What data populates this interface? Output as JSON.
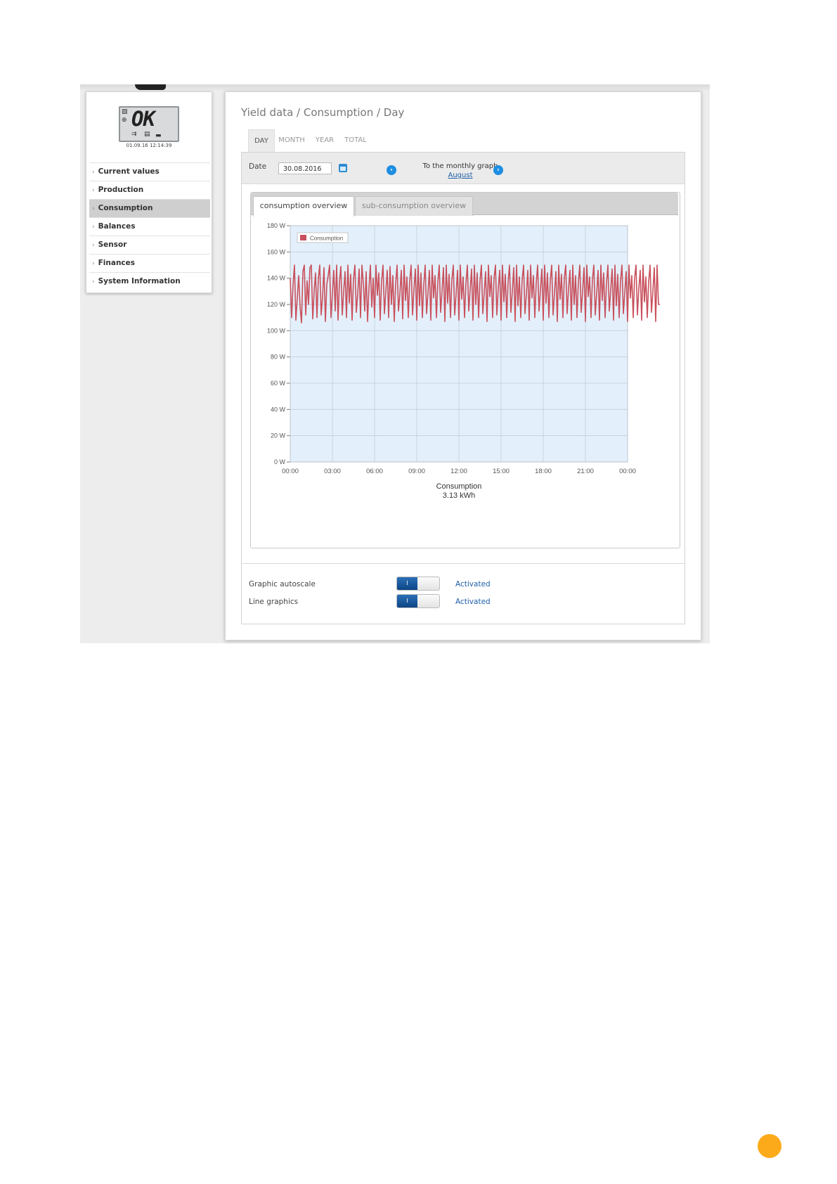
{
  "device": {
    "status_text": "OK",
    "timestamp": "01.09.16 12:14:39"
  },
  "sidebar": {
    "items": [
      {
        "label": "Current values"
      },
      {
        "label": "Production"
      },
      {
        "label": "Consumption"
      },
      {
        "label": "Balances"
      },
      {
        "label": "Sensor"
      },
      {
        "label": "Finances"
      },
      {
        "label": "System Information"
      }
    ],
    "active_item": "Consumption"
  },
  "main": {
    "title": "Yield data / Consumption / Day",
    "period_tabs": [
      {
        "label": "DAY"
      },
      {
        "label": "MONTH"
      },
      {
        "label": "YEAR"
      },
      {
        "label": "TOTAL"
      }
    ],
    "active_period": "DAY",
    "date_label": "Date",
    "date_value": "30.08.2016",
    "monthly_label": "To the monthly graph",
    "monthly_link": "August",
    "chart_tabs": [
      {
        "label": "consumption overview"
      },
      {
        "label": "sub-consumption overview"
      }
    ],
    "active_chart_tab": "consumption overview",
    "settings": [
      {
        "label": "Graphic autoscale",
        "toggle_text": "I",
        "state": "Activated"
      },
      {
        "label": "Line graphics",
        "toggle_text": "I",
        "state": "Activated"
      }
    ]
  },
  "colors": {
    "series": "#c8505c",
    "plot_bg": "#e3f0fb",
    "accent": "#1d8ee2",
    "page_marker": "#fcaa1a"
  },
  "chart_data": {
    "type": "line",
    "x_ticks": [
      "00:00",
      "03:00",
      "06:00",
      "09:00",
      "12:00",
      "15:00",
      "18:00",
      "21:00",
      "00:00"
    ],
    "y_ticks": [
      "0 W",
      "20 W",
      "40 W",
      "60 W",
      "80 W",
      "100 W",
      "120 W",
      "140 W",
      "160 W",
      "180 W"
    ],
    "ylim": [
      0,
      180
    ],
    "xlim": [
      0,
      24
    ],
    "grid": true,
    "legend_position": "top-left",
    "summary_label": "Consumption",
    "summary_value": "3.13 kWh",
    "series": [
      {
        "name": "Consumption",
        "x_step_hours": 0.1,
        "values": [
          140,
          110,
          135,
          150,
          108,
          125,
          142,
          118,
          106,
          145,
          150,
          112,
          138,
          120,
          148,
          150,
          109,
          130,
          144,
          110,
          140,
          150,
          112,
          126,
          148,
          107,
          135,
          142,
          150,
          110,
          128,
          146,
          115,
          150,
          108,
          137,
          149,
          112,
          130,
          145,
          110,
          150,
          121,
          143,
          108,
          139,
          150,
          114,
          128,
          147,
          110,
          150,
          136,
          115,
          145,
          107,
          132,
          150,
          118,
          140,
          110,
          150,
          127,
          144,
          108,
          138,
          150,
          113,
          130,
          146,
          110,
          149,
          120,
          142,
          107,
          136,
          150,
          115,
          128,
          146,
          109,
          150,
          123,
          141,
          110,
          138,
          150,
          112,
          131,
          147,
          108,
          150,
          119,
          144,
          110,
          135,
          150,
          113,
          129,
          146,
          108,
          150,
          125,
          142,
          110,
          137,
          150,
          114,
          130,
          148,
          107,
          150,
          121,
          143,
          110,
          139,
          150,
          112,
          128,
          146,
          108,
          150,
          124,
          141,
          110,
          136,
          150,
          115,
          131,
          147,
          108,
          150,
          120,
          144,
          110,
          138,
          150,
          113,
          129,
          145,
          107,
          150,
          126,
          142,
          110,
          140,
          150,
          112,
          132,
          146,
          108,
          150,
          122,
          143,
          110,
          137,
          150,
          114,
          130,
          148,
          107,
          150,
          119,
          141,
          110,
          139,
          150,
          113,
          128,
          146,
          108,
          150,
          125,
          142,
          110,
          136,
          150,
          115,
          131,
          147,
          108,
          150,
          121,
          144,
          110,
          138,
          150,
          112,
          129,
          145,
          107,
          150,
          124,
          143,
          110,
          140,
          150,
          113,
          132,
          146,
          108,
          150,
          120,
          142,
          110,
          137,
          150,
          114,
          130,
          148,
          107,
          150,
          126,
          141,
          110,
          139,
          150,
          112,
          128,
          146,
          108,
          150,
          123,
          144,
          110,
          136,
          150,
          115,
          131,
          147,
          108,
          150,
          119,
          143,
          110,
          138,
          150,
          113,
          129,
          145,
          107,
          150,
          125,
          142,
          110,
          140,
          150,
          112,
          132,
          146,
          108,
          150,
          122,
          141,
          110,
          137,
          150,
          114,
          130,
          148,
          107,
          150,
          120,
          120
        ]
      }
    ]
  }
}
